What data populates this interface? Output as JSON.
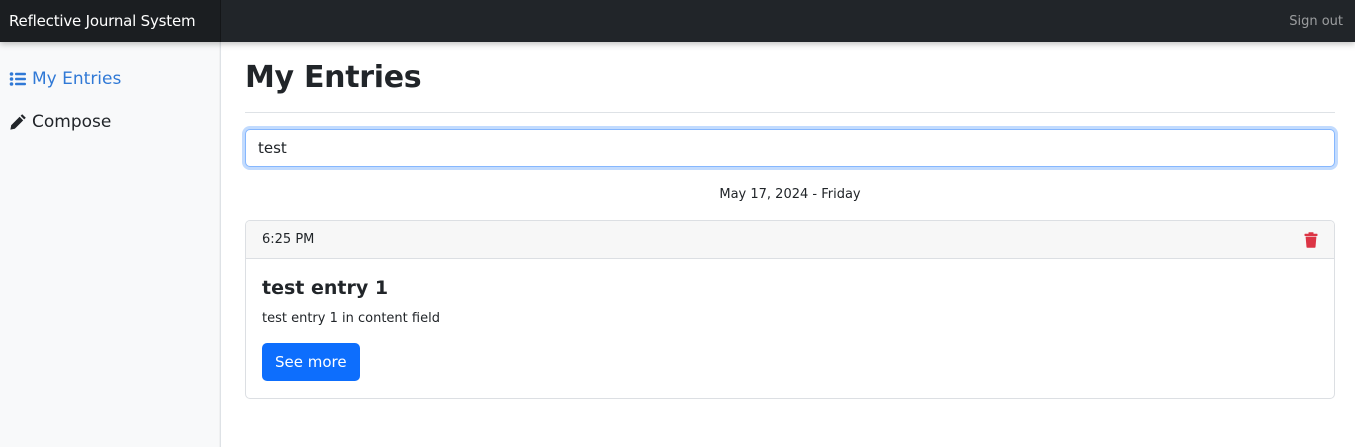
{
  "navbar": {
    "brand": "Reflective Journal System",
    "signout_label": "Sign out"
  },
  "sidebar": {
    "items": [
      {
        "label": "My Entries",
        "icon": "list-icon",
        "active": true
      },
      {
        "label": "Compose",
        "icon": "pencil-icon",
        "active": false
      }
    ]
  },
  "main": {
    "title": "My Entries",
    "search": {
      "value": "test",
      "placeholder": ""
    },
    "date_heading": "May 17, 2024 - Friday",
    "entries": [
      {
        "time": "6:25 PM",
        "title": "test entry 1",
        "content": "test entry 1 in content field",
        "button_label": "See more"
      }
    ]
  },
  "colors": {
    "navbar_bg": "#212529",
    "active_link": "#3079d6",
    "primary_button": "#0d6efd",
    "delete_icon": "#dc3545"
  }
}
